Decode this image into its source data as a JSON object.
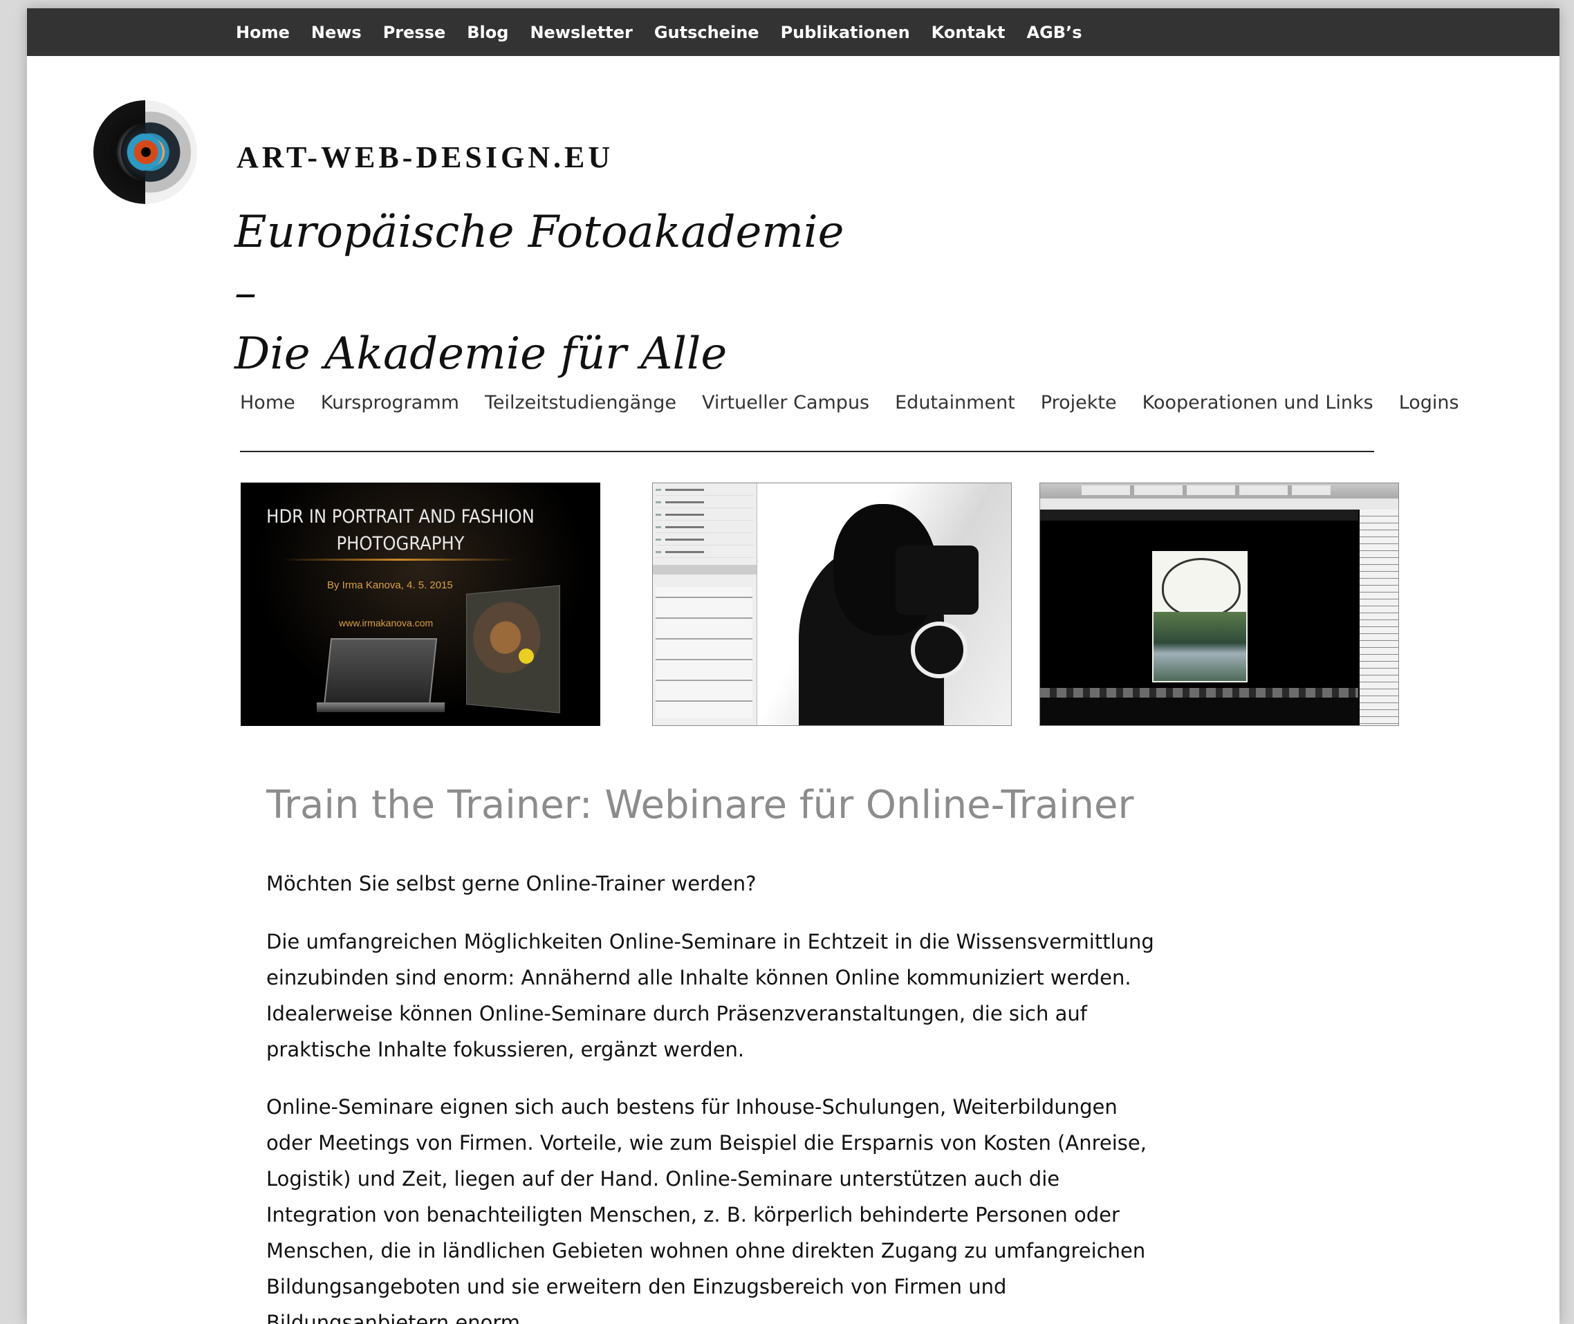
{
  "top_nav": {
    "items": [
      "Home",
      "News",
      "Presse",
      "Blog",
      "Newsletter",
      "Gutscheine",
      "Publikationen",
      "Kontakt",
      "AGB’s"
    ]
  },
  "header": {
    "logo_icon": "eye-logo-icon",
    "site_name": "ART-WEB-DESIGN.EU",
    "tagline_line1": "Europäische Fotoakademie –",
    "tagline_line2": "Die Akademie für Alle"
  },
  "main_nav": {
    "items": [
      "Home",
      "Kursprogramm",
      "Teilzeitstudiengänge",
      "Virtueller Campus",
      "Edutainment",
      "Projekte",
      "Kooperationen und Links",
      "Logins"
    ]
  },
  "gallery": {
    "thumb1": {
      "title": "HDR IN PORTRAIT AND FASHION PHOTOGRAPHY",
      "byline": "By Irma Kanova, 4. 5. 2015",
      "url": "www.irmakanova.com"
    }
  },
  "article": {
    "headline": "Train the Trainer: Webinare für Online-Trainer",
    "paragraph1": "Möchten Sie selbst gerne Online-Trainer werden?",
    "paragraph2": "Die umfangreichen Möglichkeiten Online-Seminare in Echtzeit in die Wissensvermittlung einzubinden sind enorm: Annähernd alle Inhalte können Online kommuniziert werden. Idealerweise können Online-Seminare durch Präsenzveranstaltungen, die sich auf praktische Inhalte fokussieren, ergänzt werden.",
    "paragraph3": "Online-Seminare eignen sich auch bestens für Inhouse-Schulungen, Weiterbildungen oder Meetings von Firmen. Vorteile, wie zum Beispiel die Ersparnis von Kosten (Anreise, Logistik) und Zeit, liegen auf der Hand. Online-Seminare unterstützen auch die Integration von benachteiligten Menschen, z. B. körperlich behinderte Personen oder Menschen, die in ländlichen Gebieten wohnen ohne direkten Zugang zu umfangreichen Bildungsangeboten und sie  erweitern den Einzugsbereich von Firmen und Bildungsanbietern enorm."
  },
  "colors": {
    "top_bar": "#333333",
    "headline": "#8c8c8c",
    "text": "#111111"
  }
}
